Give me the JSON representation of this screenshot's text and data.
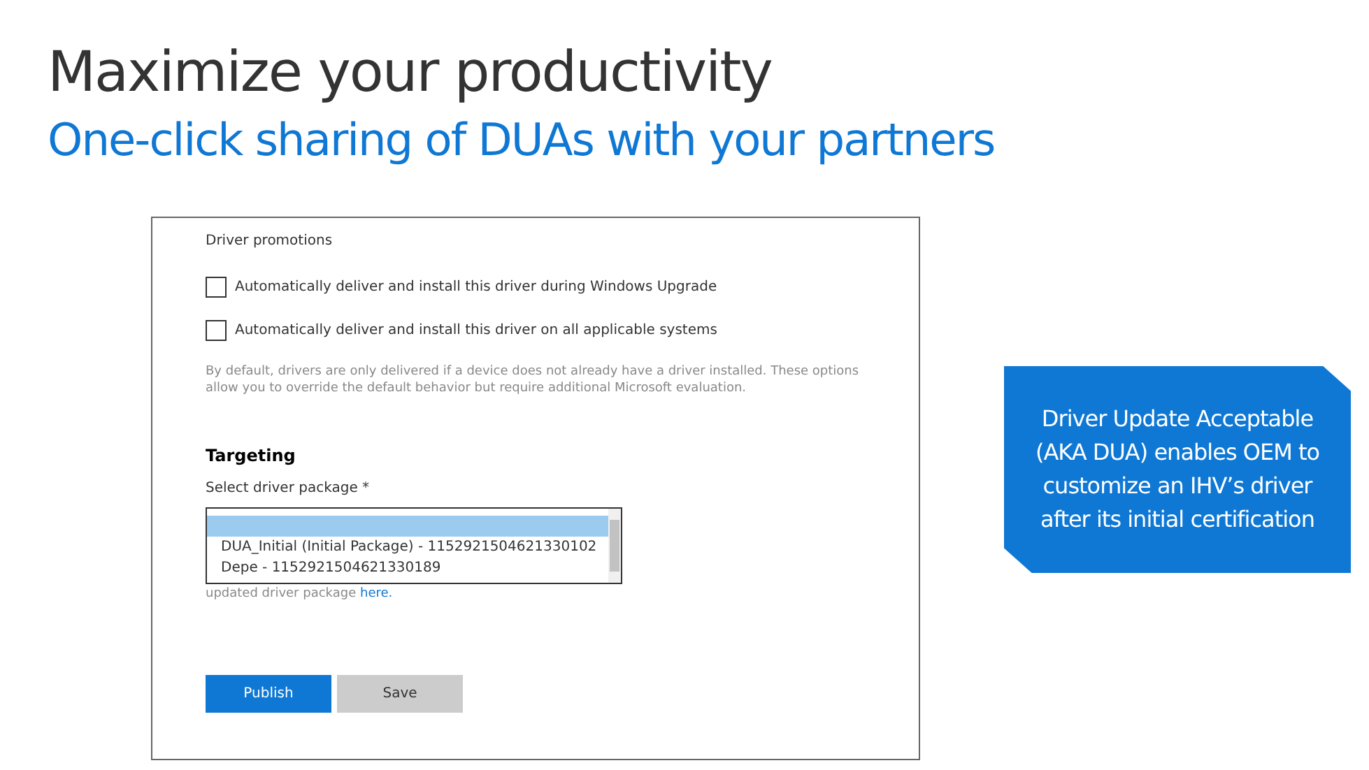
{
  "title": "Maximize your productivity",
  "subtitle": "One-click sharing of DUAs with your partners",
  "form": {
    "section_label": "Driver promotions",
    "options": [
      {
        "label": "Automatically deliver and install this driver during Windows Upgrade",
        "checked": false
      },
      {
        "label": "Automatically deliver and install this driver on all applicable systems",
        "checked": false
      }
    ],
    "note": "By default, drivers are only delivered if a device does not already have a driver installed. These options allow you to override the default behavior but require additional Microsoft evaluation.",
    "targeting_heading": "Targeting",
    "select_label": "Select driver package *",
    "packages": [
      {
        "selected": true
      },
      {
        "label": "DUA_Initial (Initial Package) - 1152921504621330102",
        "selected": false
      },
      {
        "label": "Depe - 1152921504621330189",
        "selected": false
      }
    ],
    "hint": "updated driver package ",
    "hint_link": "here.",
    "buttons": [
      {
        "label": "Publish",
        "kind": "primary"
      },
      {
        "label": "Save",
        "kind": "secondary"
      }
    ]
  },
  "callout": "Driver Update Acceptable (AKA DUA) enables OEM to customize an IHV’s driver after its initial certification"
}
